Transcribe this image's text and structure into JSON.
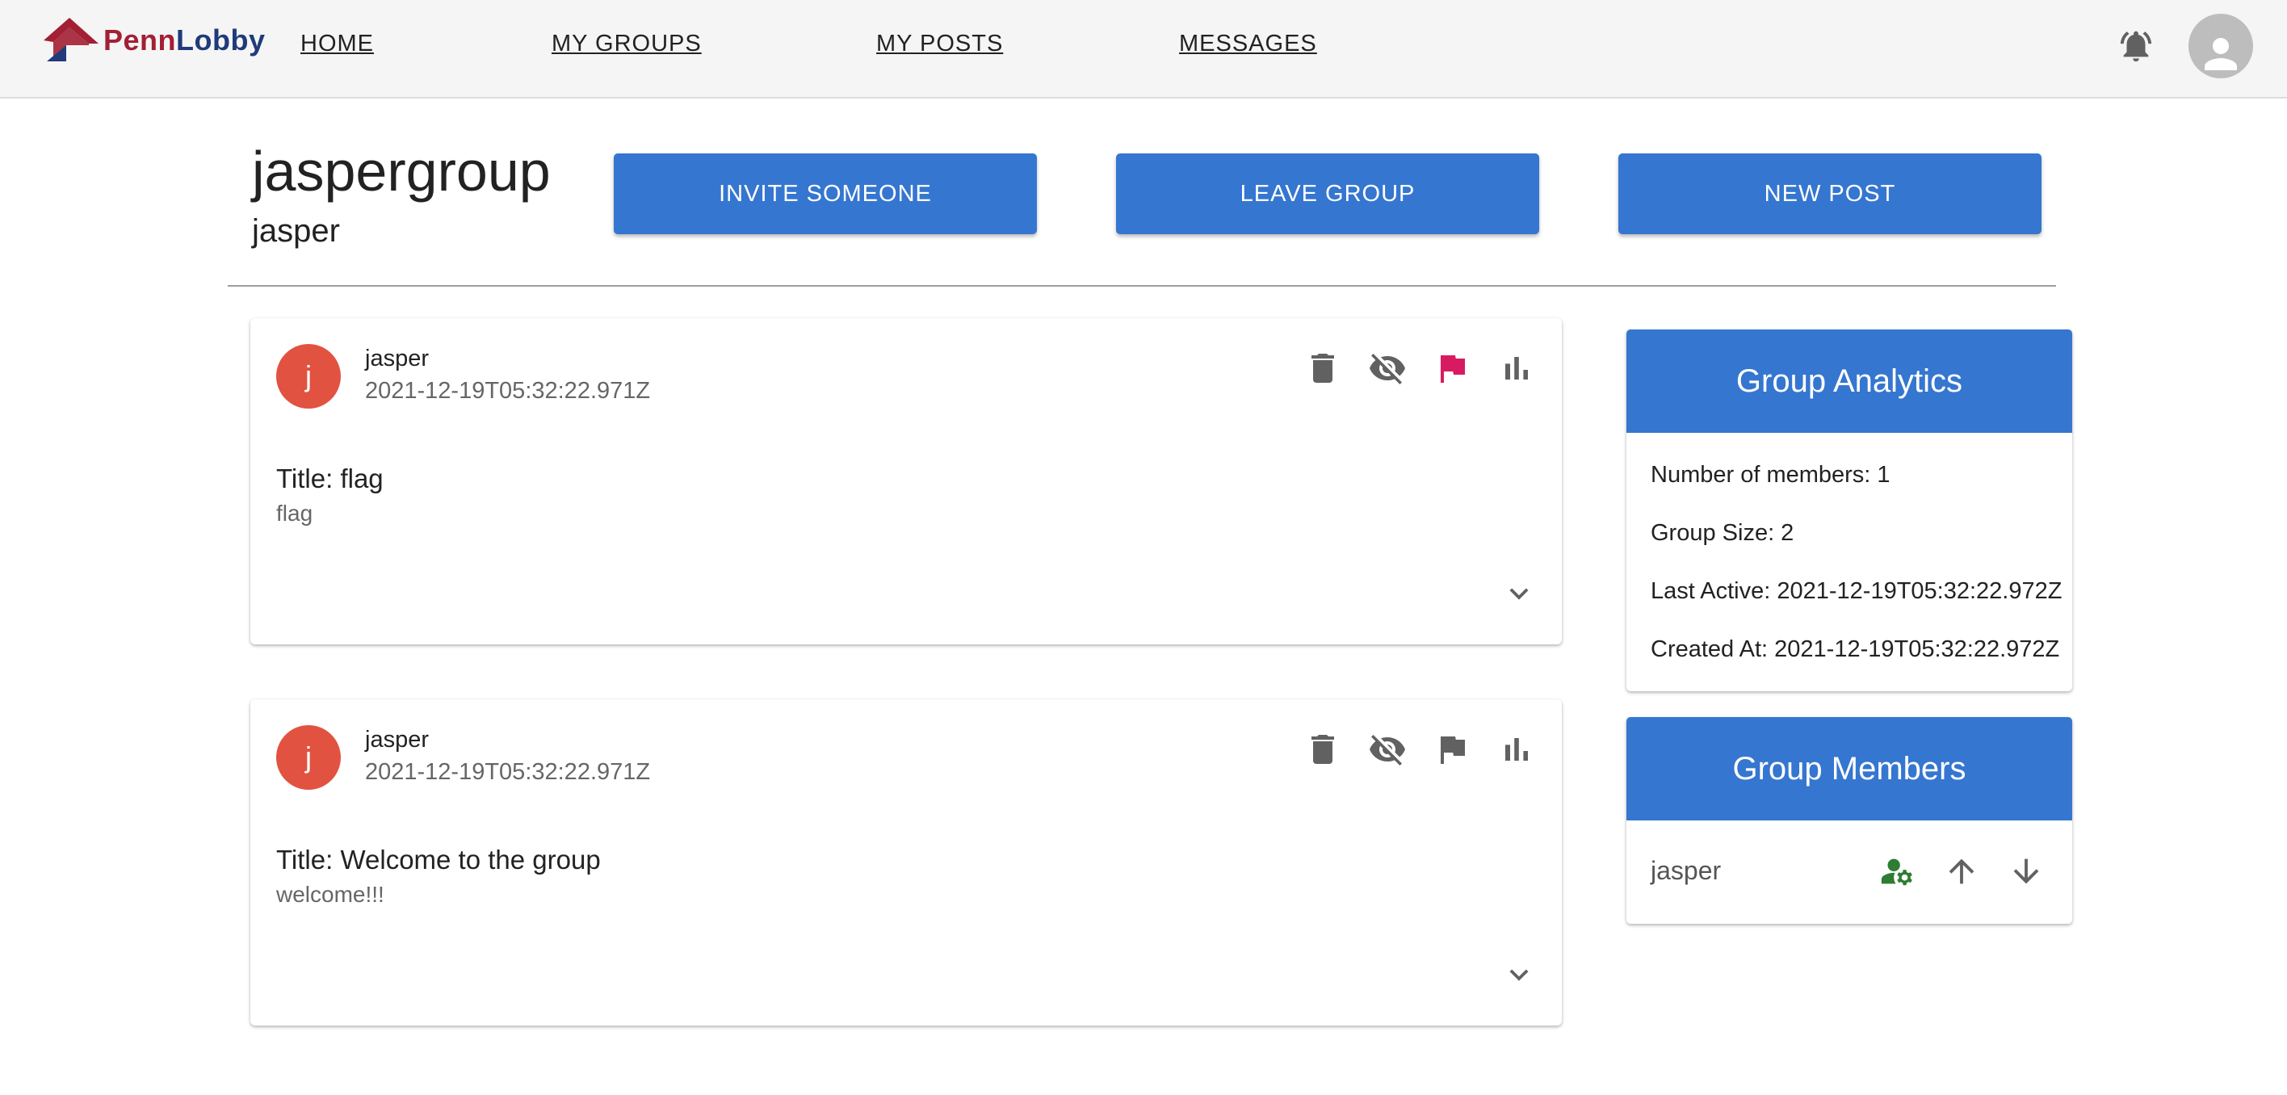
{
  "brand": {
    "penn": "Penn",
    "lobby": "Lobby"
  },
  "nav": {
    "home": "HOME",
    "my_groups": "MY GROUPS",
    "my_posts": "MY POSTS",
    "messages": "MESSAGES"
  },
  "header_icons": {
    "notifications": "bell-icon",
    "profile": "account-circle-icon"
  },
  "group": {
    "name": "jaspergroup",
    "owner": "jasper",
    "invite_label": "INVITE SOMEONE",
    "leave_label": "LEAVE GROUP",
    "new_post_label": "NEW POST"
  },
  "posts": [
    {
      "avatar_letter": "j",
      "author": "jasper",
      "date": "2021-12-19T05:32:22.971Z",
      "title": "Title: flag",
      "body": "flag",
      "flagged": true,
      "icons": [
        "delete-icon",
        "visibility-off-icon",
        "flag-icon",
        "bar-chart-icon",
        "expand-more-icon"
      ]
    },
    {
      "avatar_letter": "j",
      "author": "jasper",
      "date": "2021-12-19T05:32:22.971Z",
      "title": "Title: Welcome to the group",
      "body": "welcome!!!",
      "flagged": false,
      "icons": [
        "delete-icon",
        "visibility-off-icon",
        "flag-icon",
        "bar-chart-icon",
        "expand-more-icon"
      ]
    }
  ],
  "analytics": {
    "heading": "Group Analytics",
    "members": "Number of members: 1",
    "size": "Group Size: 2",
    "last_active": "Last Active: 2021-12-19T05:32:22.972Z",
    "created_at": "Created At: 2021-12-19T05:32:22.972Z"
  },
  "members_panel": {
    "heading": "Group Members",
    "members": [
      {
        "name": "jasper",
        "icons": [
          "manage-accounts-icon",
          "arrow-up-icon",
          "arrow-down-icon"
        ]
      }
    ]
  },
  "colors": {
    "primary": "#3576d0",
    "avatar": "#e25241",
    "flag_active": "#d81b60",
    "admin_icon": "#2e7d32",
    "logo_red": "#a31f34",
    "logo_blue": "#1f3b7a"
  }
}
